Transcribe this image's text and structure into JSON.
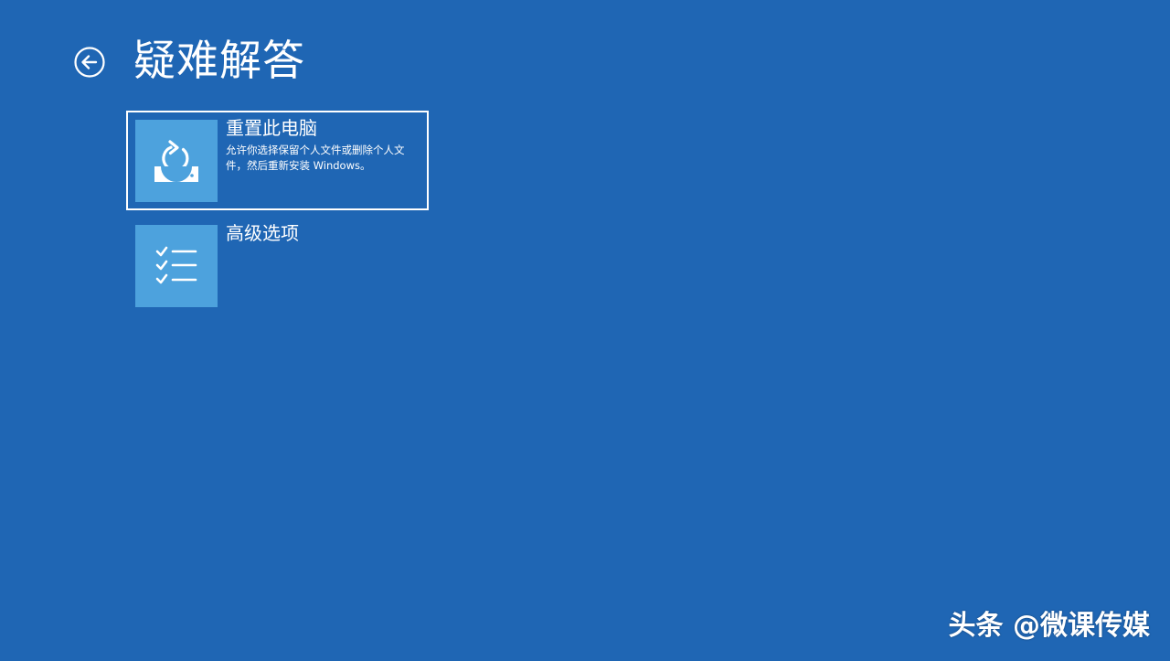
{
  "colors": {
    "background": "#1f66b4",
    "tile": "#4da2dd",
    "text": "#ffffff"
  },
  "header": {
    "back_icon": "back-arrow-circle-icon",
    "title": "疑难解答"
  },
  "options": [
    {
      "title": "重置此电脑",
      "description": "允许你选择保留个人文件或删除个人文件，然后重新安装 Windows。",
      "icon": "reset-pc-icon",
      "selected": true
    },
    {
      "title": "高级选项",
      "description": "",
      "icon": "checklist-icon",
      "selected": false
    }
  ],
  "watermark": "头条 @微课传媒"
}
